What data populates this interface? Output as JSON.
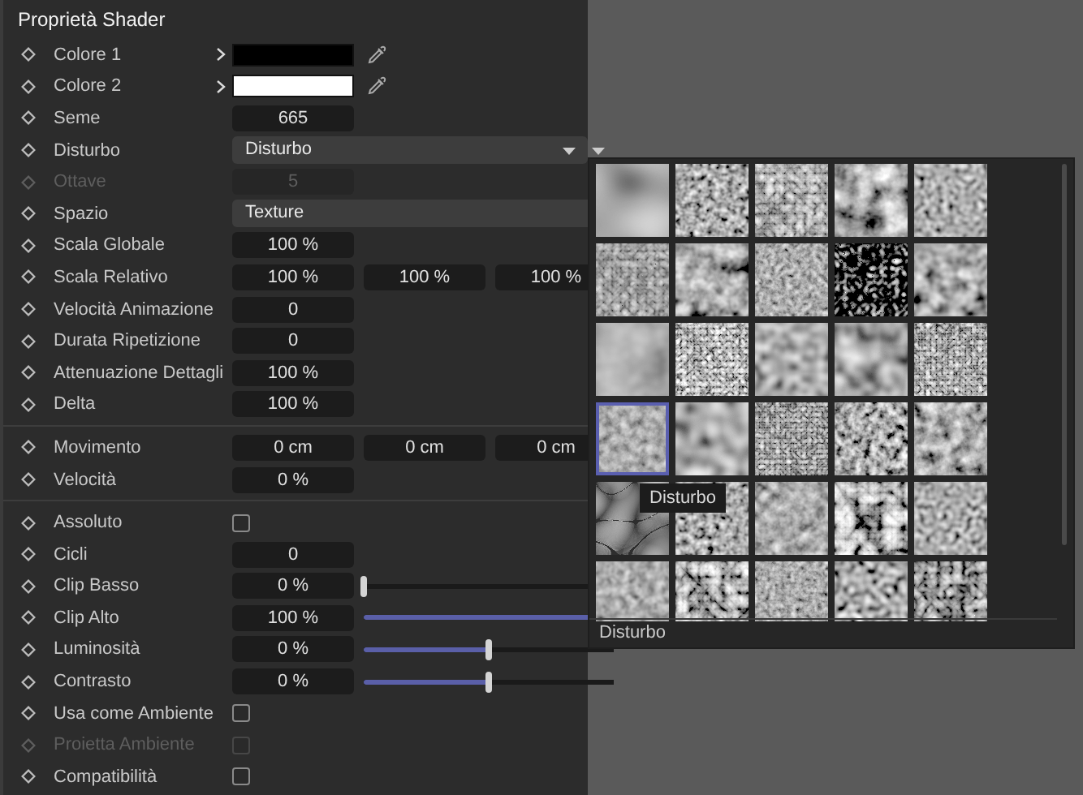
{
  "panel": {
    "title": "Proprietà Shader",
    "groups": [
      {
        "rows": [
          {
            "kind": "color",
            "label": "Colore 1",
            "color": "#000000",
            "disabled": false
          },
          {
            "kind": "color",
            "label": "Colore 2",
            "color": "#ffffff",
            "disabled": false
          },
          {
            "kind": "number",
            "label": "Seme",
            "value": "665",
            "disabled": false
          },
          {
            "kind": "dropdown",
            "label": "Disturbo",
            "value": "Disturbo",
            "disabled": false,
            "preset_button": true
          },
          {
            "kind": "number",
            "label": "Ottave",
            "value": "5",
            "disabled": true
          },
          {
            "kind": "dropdown",
            "label": "Spazio",
            "value": "Texture",
            "disabled": false,
            "preset_button": false
          },
          {
            "kind": "number",
            "label": "Scala Globale",
            "value": "100 %",
            "disabled": false
          },
          {
            "kind": "vector",
            "label": "Scala Relativo",
            "values": [
              "100 %",
              "100 %",
              "100 %"
            ],
            "disabled": false
          },
          {
            "kind": "number",
            "label": "Velocità Animazione",
            "value": "0",
            "disabled": false
          },
          {
            "kind": "number",
            "label": "Durata Ripetizione",
            "value": "0",
            "disabled": false
          },
          {
            "kind": "number",
            "label": "Attenuazione Dettagli",
            "value": "100 %",
            "disabled": false
          },
          {
            "kind": "number",
            "label": "Delta",
            "value": "100 %",
            "disabled": false
          }
        ]
      },
      {
        "rows": [
          {
            "kind": "vector",
            "label": "Movimento",
            "values": [
              "0 cm",
              "0 cm",
              "0 cm"
            ],
            "disabled": false
          },
          {
            "kind": "number",
            "label": "Velocità",
            "value": "0 %",
            "disabled": false
          }
        ]
      },
      {
        "rows": [
          {
            "kind": "checkbox",
            "label": "Assoluto",
            "checked": false,
            "disabled": false
          },
          {
            "kind": "number",
            "label": "Cicli",
            "value": "0",
            "disabled": false
          },
          {
            "kind": "slider",
            "label": "Clip Basso",
            "value": "0 %",
            "level": 0,
            "disabled": false
          },
          {
            "kind": "slider",
            "label": "Clip Alto",
            "value": "100 %",
            "level": 1,
            "disabled": false
          },
          {
            "kind": "slider",
            "label": "Luminosità",
            "value": "0 %",
            "level": 0.5,
            "disabled": false
          },
          {
            "kind": "slider",
            "label": "Contrasto",
            "value": "0 %",
            "level": 0.5,
            "disabled": false
          },
          {
            "kind": "checkbox",
            "label": "Usa come Ambiente",
            "checked": false,
            "disabled": false
          },
          {
            "kind": "checkbox",
            "label": "Proietta Ambiente",
            "checked": false,
            "disabled": true
          },
          {
            "kind": "checkbox",
            "label": "Compatibilità",
            "checked": false,
            "disabled": false
          }
        ]
      }
    ]
  },
  "preset_popup": {
    "tooltip": "Disturbo",
    "footer": "Disturbo",
    "presets": [
      {
        "selected": false
      },
      {
        "selected": false
      },
      {
        "selected": false
      },
      {
        "selected": false
      },
      {
        "selected": false
      },
      {
        "selected": false
      },
      {
        "selected": false
      },
      {
        "selected": false
      },
      {
        "selected": false
      },
      {
        "selected": false
      },
      {
        "selected": false
      },
      {
        "selected": false
      },
      {
        "selected": false
      },
      {
        "selected": false
      },
      {
        "selected": false
      },
      {
        "selected": true
      },
      {
        "selected": false
      },
      {
        "selected": false
      },
      {
        "selected": false
      },
      {
        "selected": false
      },
      {
        "selected": false
      },
      {
        "selected": false
      },
      {
        "selected": false
      },
      {
        "selected": false
      },
      {
        "selected": false
      },
      {
        "selected": false
      },
      {
        "selected": false
      },
      {
        "selected": false
      },
      {
        "selected": false
      },
      {
        "selected": false
      }
    ]
  }
}
